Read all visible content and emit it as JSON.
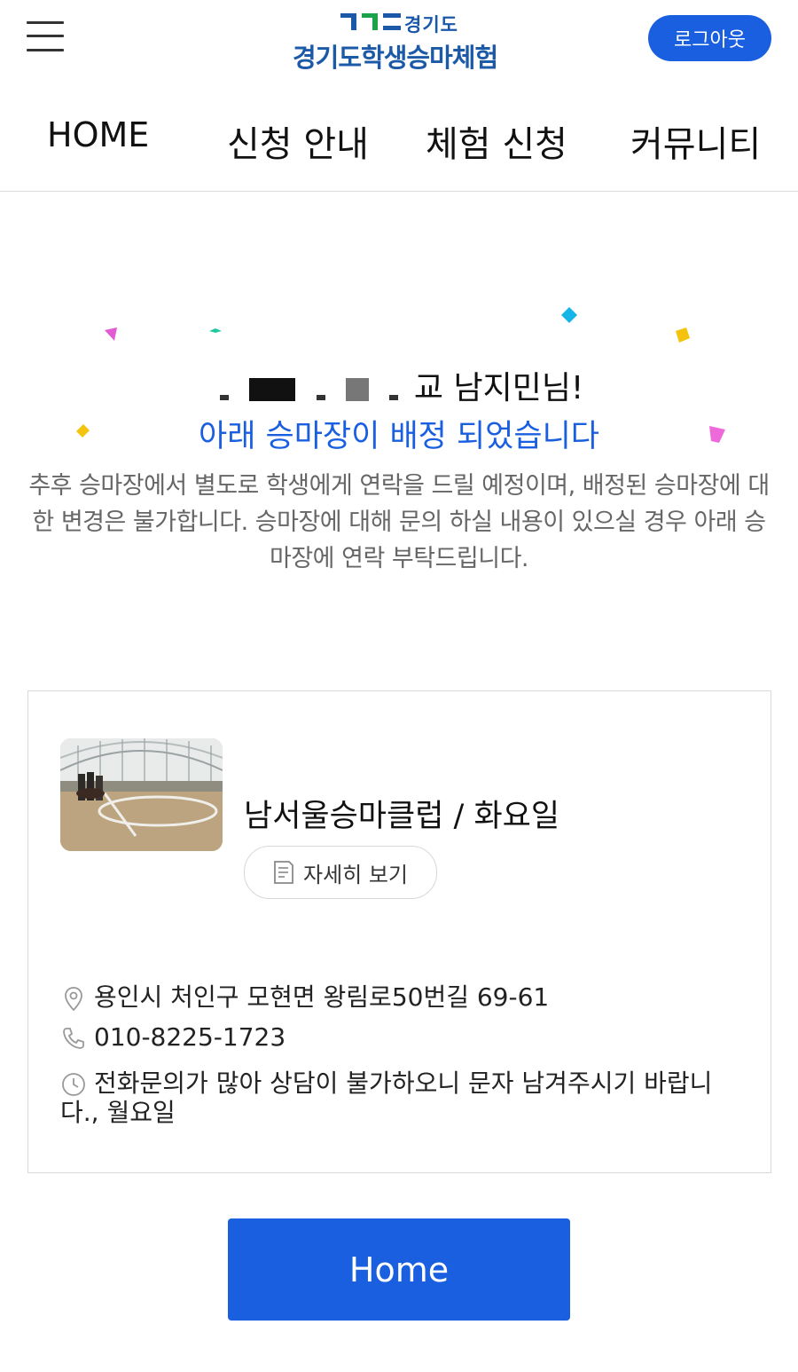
{
  "header": {
    "logo_region": "경기도",
    "logo_title": "경기도학생승마체험",
    "logout_label": "로그아웃"
  },
  "nav": {
    "items": [
      {
        "label": "HOME"
      },
      {
        "label": "신청 안내"
      },
      {
        "label": "체험 신청"
      },
      {
        "label": "커뮤니티"
      }
    ]
  },
  "message": {
    "greeting_suffix": "교 남지민님!",
    "headline": "아래 승마장이 배정 되었습니다",
    "notice": "추후 승마장에서 별도로 학생에게 연락을 드릴 예정이며, 배정된 승마장에 대한 변경은 불가합니다. 승마장에 대해 문의 하실 내용이 있으실 경우 아래 승마장에 연락 부탁드립니다."
  },
  "card": {
    "club_name": "남서울승마클럽 / 화요일",
    "detail_label": "자세히 보기",
    "address": "용인시 처인구 모현면 왕림로50번길 69-61",
    "phone": "010-8225-1723",
    "note": "전화문의가 많아 상담이 불가하오니 문자 남겨주시기 바랍니다., 월요일"
  },
  "home_button_label": "Home",
  "colors": {
    "accent": "#1a5fe0",
    "logo_blue": "#1c5aa8",
    "logo_green": "#1aa34a"
  },
  "icons": {
    "menu": "hamburger-menu-icon",
    "document": "document-icon",
    "location": "location-pin-icon",
    "phone": "phone-icon",
    "clock": "clock-icon"
  }
}
